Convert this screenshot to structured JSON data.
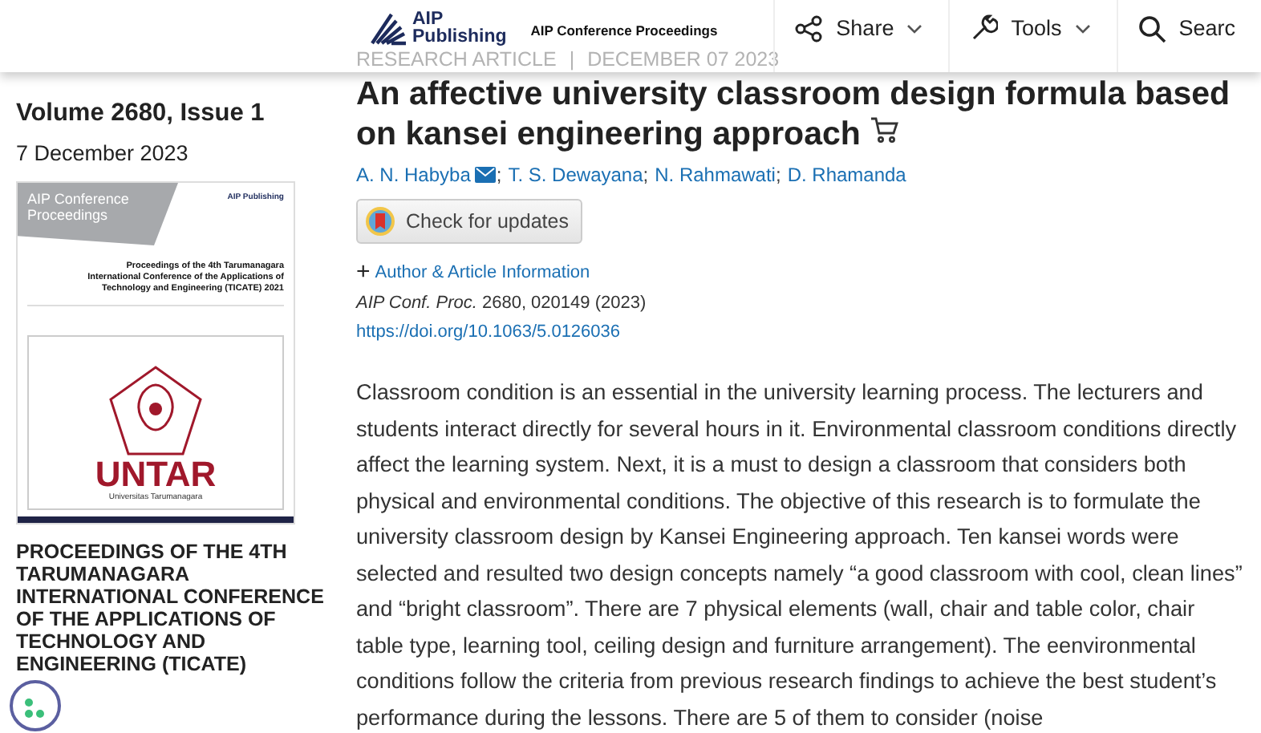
{
  "header": {
    "logo_text": "AIP",
    "logo_subtext": "Publishing",
    "journal": "AIP Conference Proceedings",
    "actions": [
      {
        "kind": "share",
        "label": "Share"
      },
      {
        "kind": "tools",
        "label": "Tools"
      },
      {
        "kind": "search",
        "label": "Searc"
      }
    ]
  },
  "sidebar": {
    "volume": "Volume 2680, Issue 1",
    "date": "7 December 2023",
    "cover": {
      "series": "AIP Conference Proceedings",
      "publisher": "AIP Publishing",
      "title": "Proceedings of the 4th Tarumanagara International Conference of the Applications of Technology and Engineering (TICATE) 2021",
      "university": "UNTAR",
      "university_name": "Universitas Tarumanagara"
    },
    "proceedings_title": "PROCEEDINGS OF THE 4TH TARUMANAGARA INTERNATIONAL CONFERENCE OF THE APPLICATIONS OF TECHNOLOGY AND ENGINEERING (TICATE)"
  },
  "article": {
    "type": "RESEARCH ARTICLE",
    "meta_divider": "|",
    "date": "DECEMBER 07 2023",
    "title": "An affective university classroom design formula based on kansei engineering approach",
    "authors": [
      {
        "name": "A. N. Habyba",
        "corresponding": true,
        "separator": ";"
      },
      {
        "name": "T. S. Dewayana",
        "corresponding": false,
        "separator": ";"
      },
      {
        "name": "N. Rahmawati",
        "corresponding": false,
        "separator": ";"
      },
      {
        "name": "D. Rhamanda",
        "corresponding": false
      }
    ],
    "check_updates": "Check for updates",
    "info_toggle": "+",
    "info_label": "Author & Article Information",
    "journal_abbr": "AIP Conf. Proc.",
    "citation": "2680, 020149 (2023)",
    "doi": "https://doi.org/10.1063/5.0126036",
    "abstract": "Classroom condition is an essential in the university learning process. The lecturers and students interact directly for several hours in it. Environmental classroom conditions directly affect the learning system. Next, it is a must to design a classroom that considers both physical and environmental conditions. The objective of this research is to formulate the university classroom design by Kansei Engineering approach. Ten kansei words were selected and resulted two design concepts namely “a good classroom with cool, clean lines” and “bright classroom”. There are 7 physical elements (wall, chair and table color, chair table type, learning tool, ceiling design and furniture arrangement). The eenvironmental conditions follow the criteria from previous research findings to achieve the best student’s performance during the lessons. There are 5 of them to consider (noise"
  }
}
